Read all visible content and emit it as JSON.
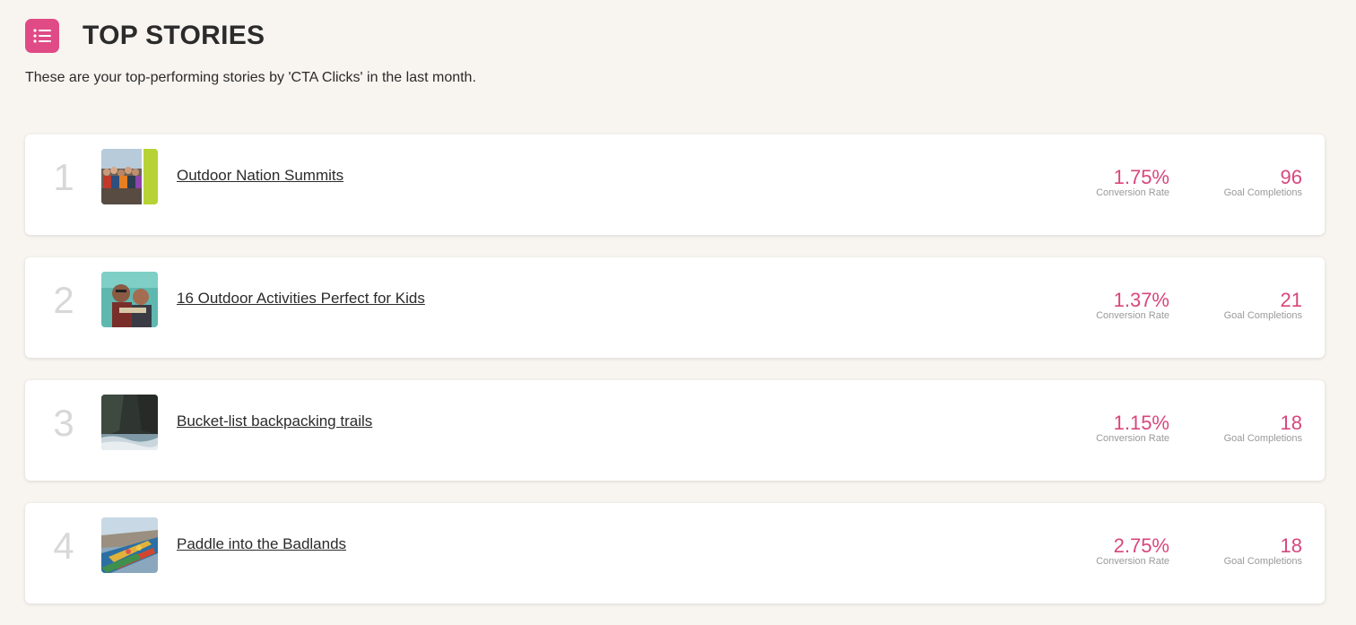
{
  "header": {
    "icon": "list-icon",
    "accent_color": "#e04b86",
    "title": "TOP STORIES",
    "subtitle": "These are your top-performing stories by 'CTA Clicks' in the last month."
  },
  "metric_color": "#d8467c",
  "stories": [
    {
      "rank": "1",
      "title": "Outdoor Nation Summits",
      "conversion_rate": "1.75%",
      "conversion_label": "Conversion Rate",
      "goal_completions": "96",
      "goal_label": "Goal Completions"
    },
    {
      "rank": "2",
      "title": "16 Outdoor Activities Perfect for Kids",
      "conversion_rate": "1.37%",
      "conversion_label": "Conversion Rate",
      "goal_completions": "21",
      "goal_label": "Goal Completions"
    },
    {
      "rank": "3",
      "title": "Bucket-list backpacking trails",
      "conversion_rate": "1.15%",
      "conversion_label": "Conversion Rate",
      "goal_completions": "18",
      "goal_label": "Goal Completions"
    },
    {
      "rank": "4",
      "title": "Paddle into the Badlands",
      "conversion_rate": "2.75%",
      "conversion_label": "Conversion Rate",
      "goal_completions": "18",
      "goal_label": "Goal Completions"
    }
  ]
}
